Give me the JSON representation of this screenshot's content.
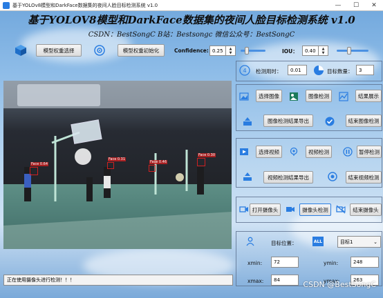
{
  "window": {
    "title": "基于YOLOv8模型和DarkFace数据集的夜间人脸目标检测系统 v1.0",
    "minimize": "—",
    "maximize": "☐",
    "close": "✕"
  },
  "header": {
    "title": "基于YOLOV8模型和DarkFace数据集的夜间人脸目标检测系统 v1.0",
    "subtitle": "CSDN：BestSongC   B站：Bestsongc   微信公众号：BestSongC"
  },
  "toolbar": {
    "select_weights": "模型权重选择",
    "init_weights": "模型权重初始化",
    "confidence_label": "Confidence:",
    "confidence_value": "0.25",
    "iou_label": "IOU：",
    "iou_value": "0.40",
    "confidence_level": 0.25,
    "iou_level": 0.4
  },
  "stats": {
    "time_label": "检测用时：",
    "time_value": "0.01",
    "count_label": "目标数量：",
    "count_value": "3"
  },
  "image": {
    "select": "选择图像",
    "detect": "图像检测",
    "show": "结果展示",
    "export": "图像检测结果导出",
    "stop": "结束图像检测"
  },
  "video": {
    "select": "选择视频",
    "detect": "视频检测",
    "pause": "暂停检测",
    "export": "视频检测结果导出",
    "stop": "结束视频检测"
  },
  "camera": {
    "open": "打开摄像头",
    "detect": "摄像头检测",
    "stop": "结束摄像头"
  },
  "target": {
    "label": "目标位置：",
    "all_badge": "ALL",
    "selected": "目标1",
    "xmin_label": "xmin:",
    "xmin": "72",
    "ymin_label": "ymin:",
    "ymin": "248",
    "xmax_label": "xmax:",
    "xmax": "84",
    "ymax_label": "ymax:",
    "ymax": "263"
  },
  "preview": {
    "faces": [
      {
        "label": "Face 0.64"
      },
      {
        "label": "Face 0.31"
      },
      {
        "label": "Face 0.46"
      },
      {
        "label": "Face 0.30"
      }
    ]
  },
  "status": "正在使用摄像头进行检测！！！",
  "watermark": "CSDN @BestSongC",
  "colors": {
    "accent": "#2a7de1",
    "box": "#d02020",
    "slider": "#4a90e2"
  }
}
